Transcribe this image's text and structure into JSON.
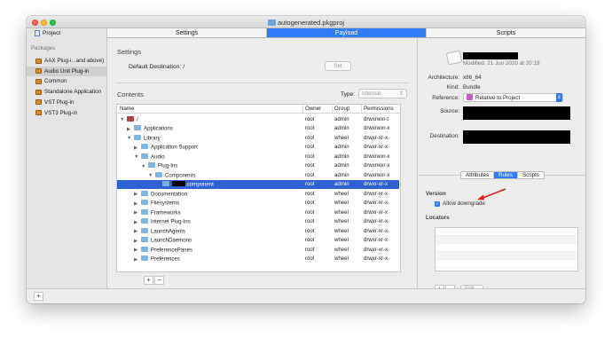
{
  "window": {
    "title": "autogenerated.pkgproj"
  },
  "sidebar": {
    "project_label": "Project",
    "packages_header": "Packages",
    "items": [
      {
        "label": "AAX Plug-i...and above)",
        "selected": false
      },
      {
        "label": "Audio Unit Plug-in",
        "selected": true
      },
      {
        "label": "Common",
        "selected": false
      },
      {
        "label": "Standalone Application",
        "selected": false
      },
      {
        "label": "VST Plug-in",
        "selected": false
      },
      {
        "label": "VST3 Plug-in",
        "selected": false
      }
    ]
  },
  "tabs": [
    {
      "label": "Settings",
      "active": false
    },
    {
      "label": "Payload",
      "active": true
    },
    {
      "label": "Scripts",
      "active": false
    }
  ],
  "settings": {
    "header": "Settings",
    "destination_label": "Default Destination:",
    "destination_value": "/",
    "set_button": "Set"
  },
  "contents": {
    "header": "Contents",
    "type_label": "Type:",
    "type_value": "Internal",
    "columns": [
      "Name",
      "Owner",
      "Group",
      "Permissions"
    ],
    "rows": [
      {
        "name": "/",
        "owner": "root",
        "group": "admin",
        "perms": "drwxrwxr-t",
        "indent": 0,
        "open": true,
        "icon": "disk-icon"
      },
      {
        "name": "Applications",
        "owner": "root",
        "group": "admin",
        "perms": "drwxrwxr-x",
        "indent": 1,
        "open": false
      },
      {
        "name": "Library",
        "owner": "root",
        "group": "wheel",
        "perms": "drwxr-xr-x",
        "indent": 1,
        "open": true
      },
      {
        "name": "Application Support",
        "owner": "root",
        "group": "admin",
        "perms": "drwxr-xr-x",
        "indent": 2,
        "open": false
      },
      {
        "name": "Audio",
        "owner": "root",
        "group": "admin",
        "perms": "drwxrwxr-x",
        "indent": 2,
        "open": true
      },
      {
        "name": "Plug-Ins",
        "owner": "root",
        "group": "admin",
        "perms": "drwxrwxr-x",
        "indent": 3,
        "open": true
      },
      {
        "name": "Components",
        "owner": "root",
        "group": "admin",
        "perms": "drwxrwxr-x",
        "indent": 4,
        "open": true
      },
      {
        "name": ".component",
        "owner": "root",
        "group": "admin",
        "perms": "drwxr-xr-x",
        "indent": 5,
        "open": null,
        "selected": true,
        "redacted": true
      },
      {
        "name": "Documentation",
        "owner": "root",
        "group": "wheel",
        "perms": "drwxr-xr-x",
        "indent": 2,
        "open": false
      },
      {
        "name": "Filesystems",
        "owner": "root",
        "group": "wheel",
        "perms": "drwxr-xr-x",
        "indent": 2,
        "open": false
      },
      {
        "name": "Frameworks",
        "owner": "root",
        "group": "wheel",
        "perms": "drwxr-xr-x",
        "indent": 2,
        "open": false
      },
      {
        "name": "Internet Plug-Ins",
        "owner": "root",
        "group": "wheel",
        "perms": "drwxr-xr-x",
        "indent": 2,
        "open": false
      },
      {
        "name": "LaunchAgents",
        "owner": "root",
        "group": "wheel",
        "perms": "drwxr-xr-x",
        "indent": 2,
        "open": false
      },
      {
        "name": "LaunchDaemons",
        "owner": "root",
        "group": "wheel",
        "perms": "drwxr-xr-x",
        "indent": 2,
        "open": false
      },
      {
        "name": "PreferencePanes",
        "owner": "root",
        "group": "wheel",
        "perms": "drwxr-xr-x",
        "indent": 2,
        "open": false
      },
      {
        "name": "Preferences",
        "owner": "root",
        "group": "wheel",
        "perms": "drwxr-xr-x",
        "indent": 2,
        "open": false
      }
    ],
    "add_button": "+",
    "remove_button": "−"
  },
  "info": {
    "modified_label": "Modified:",
    "modified_value": "21 Jun 2020 at 20:19",
    "architecture_label": "Architecture:",
    "architecture_value": "x86_64",
    "kind_label": "Kind:",
    "kind_value": "Bundle",
    "reference_label": "Reference:",
    "reference_value": "Relative to Project",
    "source_label": "Source:",
    "destination_label": "Destination:",
    "segments": [
      {
        "label": "Attributes",
        "active": false
      },
      {
        "label": "Rules",
        "active": true
      },
      {
        "label": "Scripts",
        "active": false
      }
    ],
    "version_header": "Version",
    "allow_downgrade_label": "Allow downgrade",
    "allow_downgrade_checked": true,
    "locators_header": "Locators",
    "loc_add": "+",
    "loc_remove": "−",
    "loc_edit": "Edit...",
    "annotation_color": "#e02020"
  },
  "footer": {
    "add_button": "+"
  }
}
